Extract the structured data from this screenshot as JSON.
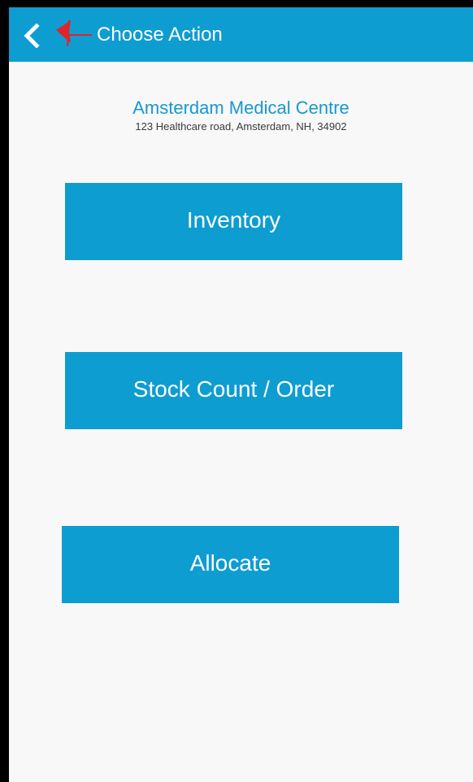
{
  "header": {
    "title": "Choose Action",
    "back_icon": "chevron-left-icon"
  },
  "facility": {
    "name": "Amsterdam Medical Centre",
    "address": "123 Healthcare road, Amsterdam, NH, 34902"
  },
  "actions": [
    {
      "label": "Inventory"
    },
    {
      "label": "Stock Count / Order"
    },
    {
      "label": "Allocate"
    }
  ],
  "colors": {
    "primary": "#0e9dd1",
    "facility_name": "#1598d3",
    "background": "#f8f8f8",
    "annotation_arrow": "#e0242b"
  }
}
